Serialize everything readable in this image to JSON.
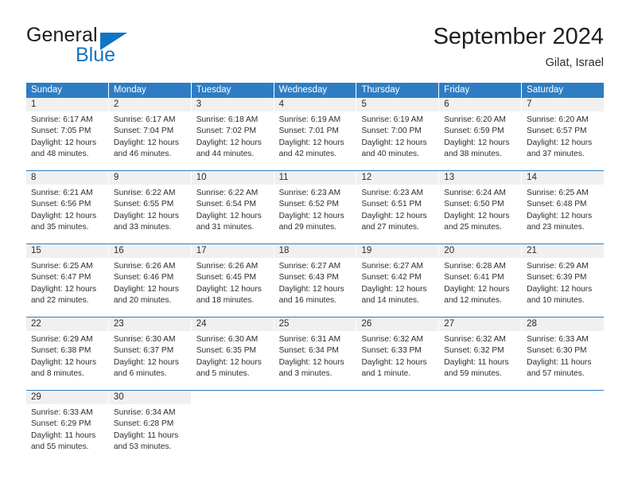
{
  "brand": {
    "name_part1": "General",
    "name_part2": "Blue",
    "triangle_color": "#1275c4"
  },
  "header": {
    "title": "September 2024",
    "subtitle": "Gilat, Israel"
  },
  "theme": {
    "header_blue": "#2e7dc4",
    "daynum_bg": "#f0f0f0",
    "text": "#2d2d2d"
  },
  "weekdays": [
    "Sunday",
    "Monday",
    "Tuesday",
    "Wednesday",
    "Thursday",
    "Friday",
    "Saturday"
  ],
  "labels": {
    "sunrise_prefix": "Sunrise:",
    "sunset_prefix": "Sunset:",
    "daylight_prefix": "Daylight:"
  },
  "weeks": [
    [
      {
        "day": "1",
        "sunrise": "Sunrise: 6:17 AM",
        "sunset": "Sunset: 7:05 PM",
        "daylight_line1": "Daylight: 12 hours",
        "daylight_line2": "and 48 minutes."
      },
      {
        "day": "2",
        "sunrise": "Sunrise: 6:17 AM",
        "sunset": "Sunset: 7:04 PM",
        "daylight_line1": "Daylight: 12 hours",
        "daylight_line2": "and 46 minutes."
      },
      {
        "day": "3",
        "sunrise": "Sunrise: 6:18 AM",
        "sunset": "Sunset: 7:02 PM",
        "daylight_line1": "Daylight: 12 hours",
        "daylight_line2": "and 44 minutes."
      },
      {
        "day": "4",
        "sunrise": "Sunrise: 6:19 AM",
        "sunset": "Sunset: 7:01 PM",
        "daylight_line1": "Daylight: 12 hours",
        "daylight_line2": "and 42 minutes."
      },
      {
        "day": "5",
        "sunrise": "Sunrise: 6:19 AM",
        "sunset": "Sunset: 7:00 PM",
        "daylight_line1": "Daylight: 12 hours",
        "daylight_line2": "and 40 minutes."
      },
      {
        "day": "6",
        "sunrise": "Sunrise: 6:20 AM",
        "sunset": "Sunset: 6:59 PM",
        "daylight_line1": "Daylight: 12 hours",
        "daylight_line2": "and 38 minutes."
      },
      {
        "day": "7",
        "sunrise": "Sunrise: 6:20 AM",
        "sunset": "Sunset: 6:57 PM",
        "daylight_line1": "Daylight: 12 hours",
        "daylight_line2": "and 37 minutes."
      }
    ],
    [
      {
        "day": "8",
        "sunrise": "Sunrise: 6:21 AM",
        "sunset": "Sunset: 6:56 PM",
        "daylight_line1": "Daylight: 12 hours",
        "daylight_line2": "and 35 minutes."
      },
      {
        "day": "9",
        "sunrise": "Sunrise: 6:22 AM",
        "sunset": "Sunset: 6:55 PM",
        "daylight_line1": "Daylight: 12 hours",
        "daylight_line2": "and 33 minutes."
      },
      {
        "day": "10",
        "sunrise": "Sunrise: 6:22 AM",
        "sunset": "Sunset: 6:54 PM",
        "daylight_line1": "Daylight: 12 hours",
        "daylight_line2": "and 31 minutes."
      },
      {
        "day": "11",
        "sunrise": "Sunrise: 6:23 AM",
        "sunset": "Sunset: 6:52 PM",
        "daylight_line1": "Daylight: 12 hours",
        "daylight_line2": "and 29 minutes."
      },
      {
        "day": "12",
        "sunrise": "Sunrise: 6:23 AM",
        "sunset": "Sunset: 6:51 PM",
        "daylight_line1": "Daylight: 12 hours",
        "daylight_line2": "and 27 minutes."
      },
      {
        "day": "13",
        "sunrise": "Sunrise: 6:24 AM",
        "sunset": "Sunset: 6:50 PM",
        "daylight_line1": "Daylight: 12 hours",
        "daylight_line2": "and 25 minutes."
      },
      {
        "day": "14",
        "sunrise": "Sunrise: 6:25 AM",
        "sunset": "Sunset: 6:48 PM",
        "daylight_line1": "Daylight: 12 hours",
        "daylight_line2": "and 23 minutes."
      }
    ],
    [
      {
        "day": "15",
        "sunrise": "Sunrise: 6:25 AM",
        "sunset": "Sunset: 6:47 PM",
        "daylight_line1": "Daylight: 12 hours",
        "daylight_line2": "and 22 minutes."
      },
      {
        "day": "16",
        "sunrise": "Sunrise: 6:26 AM",
        "sunset": "Sunset: 6:46 PM",
        "daylight_line1": "Daylight: 12 hours",
        "daylight_line2": "and 20 minutes."
      },
      {
        "day": "17",
        "sunrise": "Sunrise: 6:26 AM",
        "sunset": "Sunset: 6:45 PM",
        "daylight_line1": "Daylight: 12 hours",
        "daylight_line2": "and 18 minutes."
      },
      {
        "day": "18",
        "sunrise": "Sunrise: 6:27 AM",
        "sunset": "Sunset: 6:43 PM",
        "daylight_line1": "Daylight: 12 hours",
        "daylight_line2": "and 16 minutes."
      },
      {
        "day": "19",
        "sunrise": "Sunrise: 6:27 AM",
        "sunset": "Sunset: 6:42 PM",
        "daylight_line1": "Daylight: 12 hours",
        "daylight_line2": "and 14 minutes."
      },
      {
        "day": "20",
        "sunrise": "Sunrise: 6:28 AM",
        "sunset": "Sunset: 6:41 PM",
        "daylight_line1": "Daylight: 12 hours",
        "daylight_line2": "and 12 minutes."
      },
      {
        "day": "21",
        "sunrise": "Sunrise: 6:29 AM",
        "sunset": "Sunset: 6:39 PM",
        "daylight_line1": "Daylight: 12 hours",
        "daylight_line2": "and 10 minutes."
      }
    ],
    [
      {
        "day": "22",
        "sunrise": "Sunrise: 6:29 AM",
        "sunset": "Sunset: 6:38 PM",
        "daylight_line1": "Daylight: 12 hours",
        "daylight_line2": "and 8 minutes."
      },
      {
        "day": "23",
        "sunrise": "Sunrise: 6:30 AM",
        "sunset": "Sunset: 6:37 PM",
        "daylight_line1": "Daylight: 12 hours",
        "daylight_line2": "and 6 minutes."
      },
      {
        "day": "24",
        "sunrise": "Sunrise: 6:30 AM",
        "sunset": "Sunset: 6:35 PM",
        "daylight_line1": "Daylight: 12 hours",
        "daylight_line2": "and 5 minutes."
      },
      {
        "day": "25",
        "sunrise": "Sunrise: 6:31 AM",
        "sunset": "Sunset: 6:34 PM",
        "daylight_line1": "Daylight: 12 hours",
        "daylight_line2": "and 3 minutes."
      },
      {
        "day": "26",
        "sunrise": "Sunrise: 6:32 AM",
        "sunset": "Sunset: 6:33 PM",
        "daylight_line1": "Daylight: 12 hours",
        "daylight_line2": "and 1 minute."
      },
      {
        "day": "27",
        "sunrise": "Sunrise: 6:32 AM",
        "sunset": "Sunset: 6:32 PM",
        "daylight_line1": "Daylight: 11 hours",
        "daylight_line2": "and 59 minutes."
      },
      {
        "day": "28",
        "sunrise": "Sunrise: 6:33 AM",
        "sunset": "Sunset: 6:30 PM",
        "daylight_line1": "Daylight: 11 hours",
        "daylight_line2": "and 57 minutes."
      }
    ],
    [
      {
        "day": "29",
        "sunrise": "Sunrise: 6:33 AM",
        "sunset": "Sunset: 6:29 PM",
        "daylight_line1": "Daylight: 11 hours",
        "daylight_line2": "and 55 minutes."
      },
      {
        "day": "30",
        "sunrise": "Sunrise: 6:34 AM",
        "sunset": "Sunset: 6:28 PM",
        "daylight_line1": "Daylight: 11 hours",
        "daylight_line2": "and 53 minutes."
      },
      {
        "day": "",
        "sunrise": "",
        "sunset": "",
        "daylight_line1": "",
        "daylight_line2": ""
      },
      {
        "day": "",
        "sunrise": "",
        "sunset": "",
        "daylight_line1": "",
        "daylight_line2": ""
      },
      {
        "day": "",
        "sunrise": "",
        "sunset": "",
        "daylight_line1": "",
        "daylight_line2": ""
      },
      {
        "day": "",
        "sunrise": "",
        "sunset": "",
        "daylight_line1": "",
        "daylight_line2": ""
      },
      {
        "day": "",
        "sunrise": "",
        "sunset": "",
        "daylight_line1": "",
        "daylight_line2": ""
      }
    ]
  ]
}
